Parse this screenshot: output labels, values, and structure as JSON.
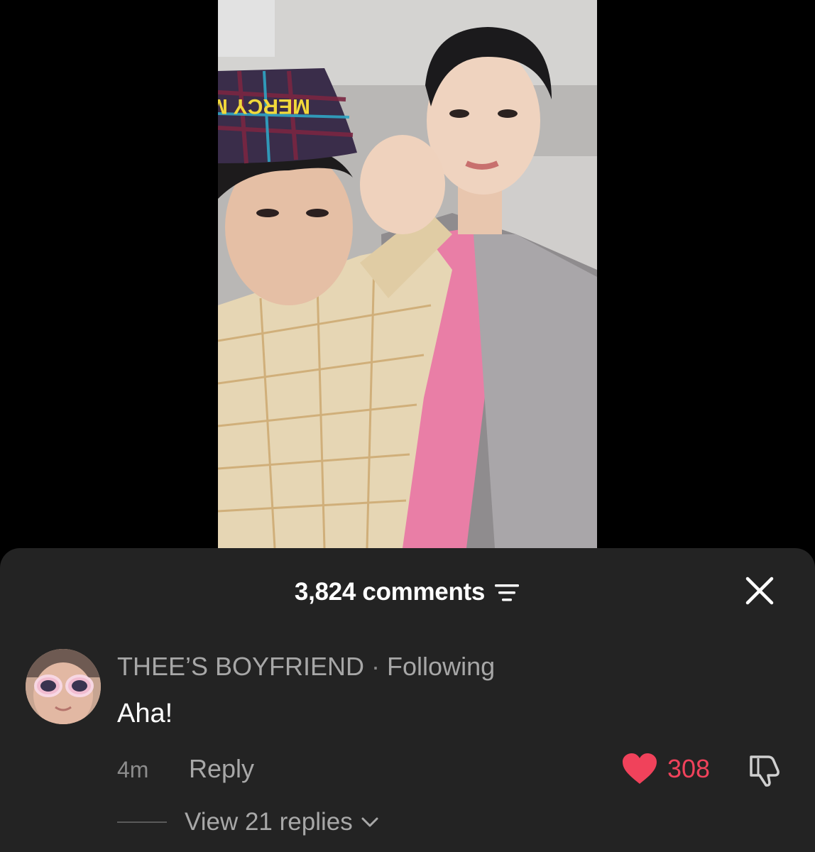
{
  "video": {
    "hat_text": "MERCY MODE"
  },
  "sheet": {
    "comments_count": "3,824 comments",
    "filter_icon": "sort-lines-icon",
    "close_icon": "close-icon"
  },
  "comment": {
    "username": "THEE’S BOYFRIEND",
    "separator": "·",
    "relationship": "Following",
    "text": "Aha!",
    "time": "4m",
    "reply_label": "Reply",
    "like_count": "308",
    "liked": true,
    "view_replies": "View 21 replies"
  },
  "colors": {
    "sheet_bg": "#232323",
    "like_red": "#f0425b",
    "muted_text": "#a8a8a8"
  }
}
